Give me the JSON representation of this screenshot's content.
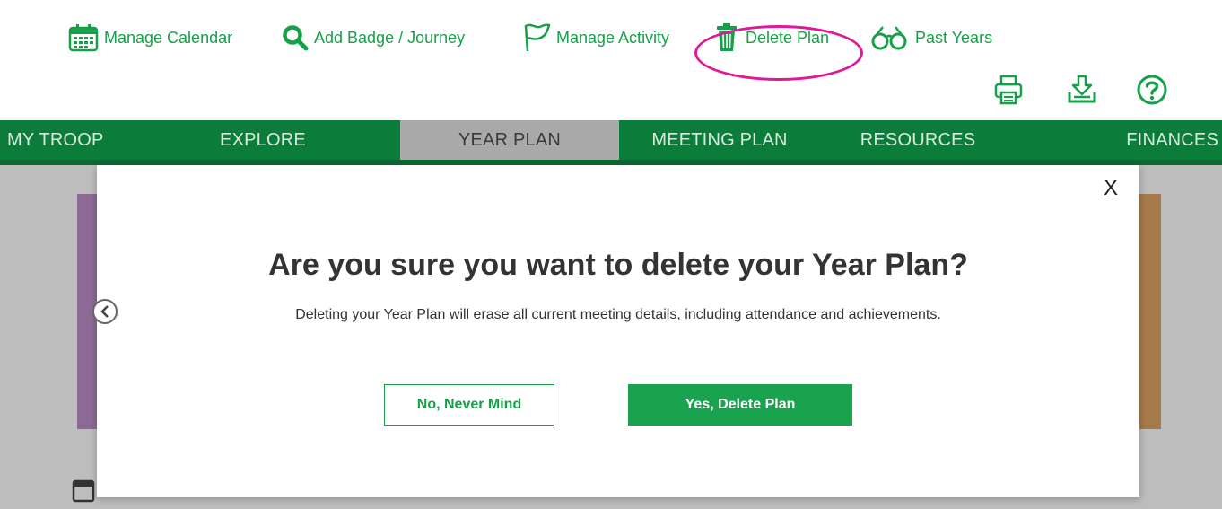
{
  "toolbar": {
    "items": [
      {
        "label": "Manage Calendar",
        "icon": "calendar-icon"
      },
      {
        "label": "Add Badge / Journey",
        "icon": "search-icon"
      },
      {
        "label": "Manage Activity",
        "icon": "flag-icon"
      },
      {
        "label": "Delete Plan",
        "icon": "trash-icon"
      },
      {
        "label": "Past Years",
        "icon": "glasses-icon"
      }
    ],
    "utilities": [
      {
        "icon": "print-icon"
      },
      {
        "icon": "download-icon"
      },
      {
        "icon": "help-icon"
      }
    ]
  },
  "nav": {
    "items": [
      "MY TROOP",
      "EXPLORE",
      "YEAR PLAN",
      "MEETING PLAN",
      "RESOURCES",
      "FINANCES"
    ],
    "active": "YEAR PLAN"
  },
  "modal": {
    "close_label": "X",
    "title": "Are you sure you want to delete your Year Plan?",
    "message": "Deleting your Year Plan will erase all current meeting details, including attendance and achievements.",
    "cancel_label": "No, Never Mind",
    "confirm_label": "Yes, Delete Plan"
  },
  "colors": {
    "brand_green": "#17a04a",
    "nav_green": "#0c7c3b",
    "highlight": "#e0189a"
  }
}
